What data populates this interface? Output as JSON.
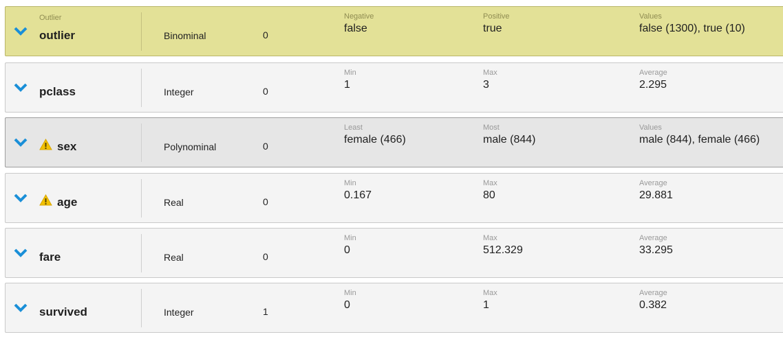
{
  "colors": {
    "role_row_background": "#e3e197",
    "selected_row_background": "#e6e6e6",
    "row_background": "#f4f4f4",
    "chevron": "#1a8fd8",
    "warning": "#f2c100"
  },
  "attributes": [
    {
      "role": "Outlier",
      "name": "outlier",
      "type": "Binominal",
      "missing": "0",
      "warning": false,
      "stats": [
        {
          "label": "Negative",
          "value": "false"
        },
        {
          "label": "Positive",
          "value": "true"
        },
        {
          "label": "Values",
          "value": "false (1300), true (10)"
        }
      ]
    },
    {
      "role": "",
      "name": "pclass",
      "type": "Integer",
      "missing": "0",
      "warning": false,
      "stats": [
        {
          "label": "Min",
          "value": "1"
        },
        {
          "label": "Max",
          "value": "3"
        },
        {
          "label": "Average",
          "value": "2.295"
        }
      ]
    },
    {
      "role": "",
      "name": "sex",
      "type": "Polynominal",
      "missing": "0",
      "warning": true,
      "stats": [
        {
          "label": "Least",
          "value": "female (466)"
        },
        {
          "label": "Most",
          "value": "male (844)"
        },
        {
          "label": "Values",
          "value": "male (844), female (466)"
        }
      ]
    },
    {
      "role": "",
      "name": "age",
      "type": "Real",
      "missing": "0",
      "warning": true,
      "stats": [
        {
          "label": "Min",
          "value": "0.167"
        },
        {
          "label": "Max",
          "value": "80"
        },
        {
          "label": "Average",
          "value": "29.881"
        }
      ]
    },
    {
      "role": "",
      "name": "fare",
      "type": "Real",
      "missing": "0",
      "warning": false,
      "stats": [
        {
          "label": "Min",
          "value": "0"
        },
        {
          "label": "Max",
          "value": "512.329"
        },
        {
          "label": "Average",
          "value": "33.295"
        }
      ]
    },
    {
      "role": "",
      "name": "survived",
      "type": "Integer",
      "missing": "1",
      "warning": false,
      "stats": [
        {
          "label": "Min",
          "value": "0"
        },
        {
          "label": "Max",
          "value": "1"
        },
        {
          "label": "Average",
          "value": "0.382"
        }
      ]
    }
  ]
}
